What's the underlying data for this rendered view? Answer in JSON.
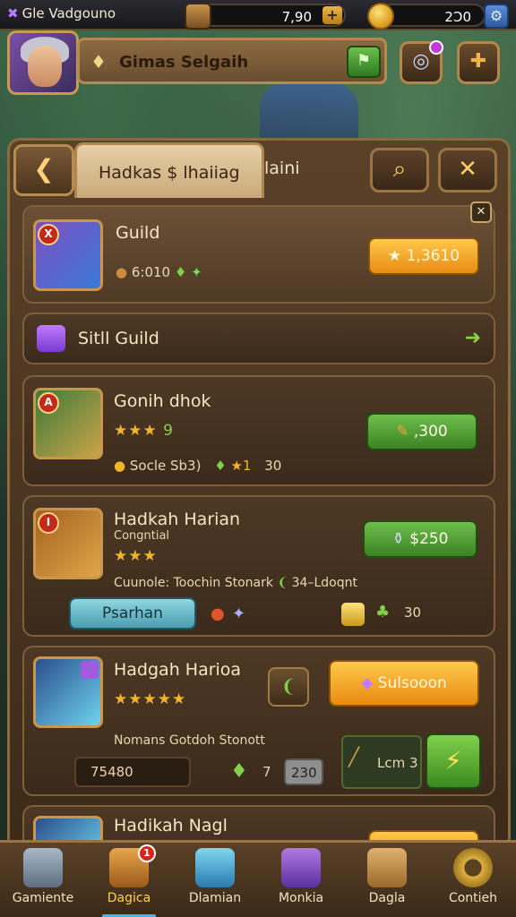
{
  "topbar": {
    "player_name": "Gle Vadgouno",
    "chest_value": "7,90",
    "coin_value": "2Ɔ0",
    "plus_label": "+",
    "settings_glyph": "⚙"
  },
  "profile": {
    "guild_name": "Gimas Selgaih",
    "pin_glyph": "♦",
    "flag_glyph": "⚑",
    "portal_glyph": "◎",
    "puzzle_glyph": "✚"
  },
  "panel": {
    "tab_title_main": "Hadkas $ lhaiiag",
    "tab_title_rest": "laini",
    "back_glyph": "❮",
    "search_glyph": "⌕",
    "close_glyph": "✕"
  },
  "cards": [
    {
      "rank": "X",
      "title": "Guild",
      "stats": "6:010",
      "price": "★ 1,3610",
      "close_glyph": "✕"
    },
    {
      "title": "Sitll Guild",
      "arrow_glyph": "➜"
    },
    {
      "rank": "A",
      "title": "Gonih dhok",
      "stars": "★★★",
      "stars_extra": "9",
      "sub": "Socle Sb3)",
      "extra": "★1",
      "extra_num": "30",
      "price": ",300"
    },
    {
      "rank": "I",
      "title": "Hadkah Harian",
      "subtitle": "Congntial",
      "stars": "★★★",
      "desc": "Cuunole: Toochin Stonark",
      "desc_tail": "34–Ldoqnt",
      "pill": "Psarhan",
      "extra_num": "30",
      "price": "$250"
    },
    {
      "title": "Hadgah Harioa",
      "stars": "★★★★★",
      "desc": "Nomans Gotdoh Stonott",
      "counter": "75480",
      "num": "7",
      "pill_num": "230",
      "item_label": "Lcm 3",
      "price": "Sulsooon"
    },
    {
      "title": "Hadikah Nagl"
    }
  ],
  "nav": [
    {
      "label": "Gamiente"
    },
    {
      "label": "Dagica",
      "badge": "1"
    },
    {
      "label": "Dlamian"
    },
    {
      "label": "Monkia"
    },
    {
      "label": "Dagla"
    },
    {
      "label": "Contieh"
    }
  ],
  "colors": {
    "gold": "#e88b12",
    "green": "#3b8224",
    "accent": "#3fb8e6"
  }
}
